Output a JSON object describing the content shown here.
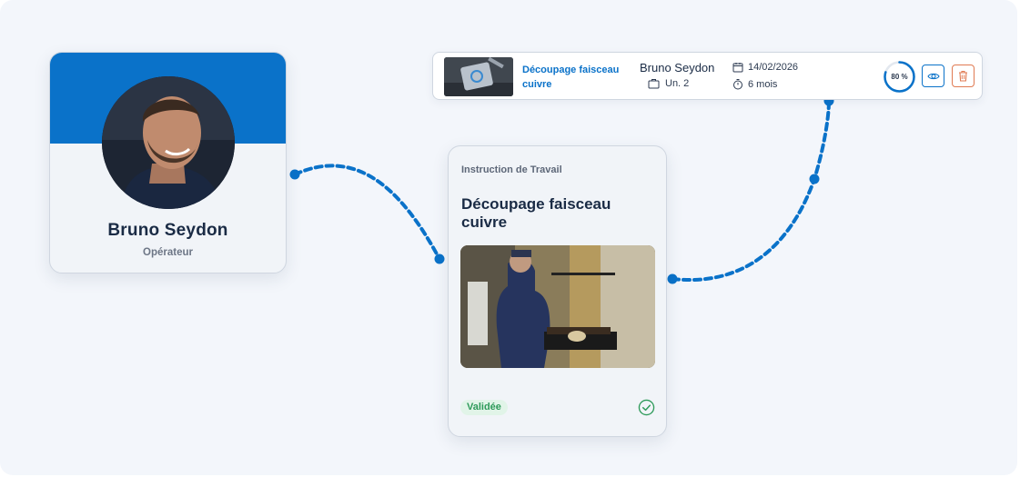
{
  "colors": {
    "accent": "#0a72c9",
    "heading": "#1a2b45",
    "success": "#2d9a59",
    "danger": "#e07a52"
  },
  "operator": {
    "name": "Bruno Seydon",
    "role": "Opérateur"
  },
  "instruction": {
    "kicker": "Instruction de Travail",
    "title": "Découpage faisceau cuivre",
    "status": "Validée",
    "status_icon": "check-circle-icon"
  },
  "task": {
    "title": "Découpage faisceau cuivre",
    "operator": "Bruno Seydon",
    "unit": "Un. 2",
    "unit_icon": "briefcase-icon",
    "date": "14/02/2026",
    "date_icon": "calendar-icon",
    "duration": "6 mois",
    "duration_icon": "stopwatch-icon",
    "progress": 80,
    "progress_label": "80 %",
    "view_icon": "eye-icon",
    "delete_icon": "trash-icon"
  }
}
